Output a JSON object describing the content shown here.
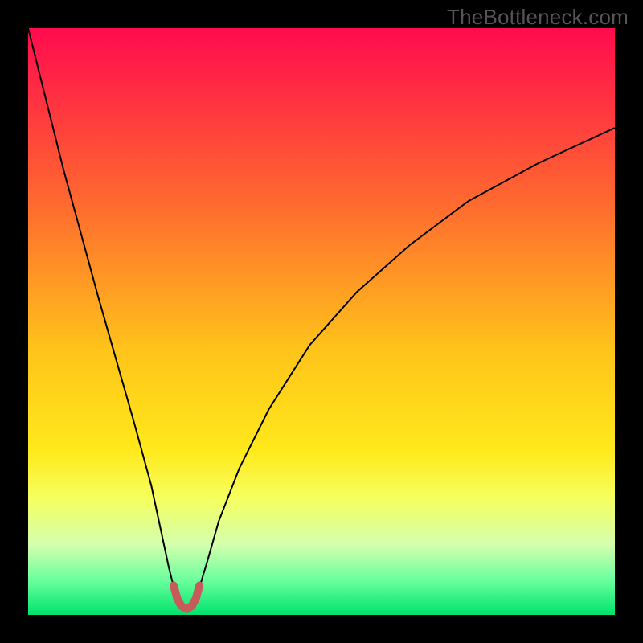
{
  "watermark": "TheBottleneck.com",
  "chart_data": {
    "type": "line",
    "title": "",
    "xlabel": "",
    "ylabel": "",
    "xlim": [
      0,
      100
    ],
    "ylim": [
      0,
      100
    ],
    "grid": false,
    "legend": false,
    "background": {
      "type": "vertical-gradient",
      "stops": [
        {
          "y": 0,
          "color": "#ff0b4e"
        },
        {
          "y": 30,
          "color": "#ff6a2f"
        },
        {
          "y": 55,
          "color": "#ffc41a"
        },
        {
          "y": 72,
          "color": "#ffe91b"
        },
        {
          "y": 80,
          "color": "#f6ff5e"
        },
        {
          "y": 88,
          "color": "#d4ffad"
        },
        {
          "y": 94,
          "color": "#6cff9e"
        },
        {
          "y": 100,
          "color": "#00e36d"
        }
      ]
    },
    "series": [
      {
        "name": "left-branch",
        "color": "#000000",
        "width": 2,
        "x": [
          0.0,
          3.0,
          6.0,
          9.0,
          12.0,
          15.0,
          18.0,
          21.0,
          22.5,
          24.0,
          25.0
        ],
        "y": [
          100.0,
          88.0,
          76.0,
          65.0,
          54.0,
          43.5,
          33.0,
          22.0,
          15.0,
          8.0,
          4.0
        ]
      },
      {
        "name": "right-branch",
        "color": "#000000",
        "width": 2,
        "x": [
          29.0,
          30.5,
          32.5,
          36.0,
          41.0,
          48.0,
          56.0,
          65.0,
          75.0,
          87.0,
          100.0
        ],
        "y": [
          4.0,
          9.0,
          16.0,
          25.0,
          35.0,
          46.0,
          55.0,
          63.0,
          70.5,
          77.0,
          83.0
        ]
      },
      {
        "name": "trough-marker",
        "color": "#c75a5a",
        "width": 10,
        "cap": "round",
        "x": [
          24.8,
          25.4,
          26.1,
          27.0,
          27.9,
          28.6,
          29.2
        ],
        "y": [
          5.0,
          2.8,
          1.5,
          1.0,
          1.5,
          2.8,
          5.0
        ]
      }
    ],
    "minimum": {
      "x": 27.0,
      "y": 1.0
    }
  }
}
